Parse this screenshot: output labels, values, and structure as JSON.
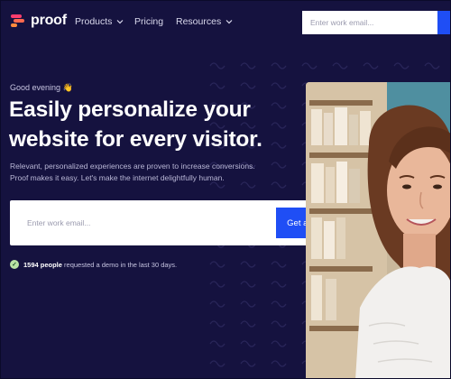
{
  "brand": {
    "name": "proof"
  },
  "nav": {
    "items": [
      {
        "label": "Products",
        "has_dropdown": true
      },
      {
        "label": "Pricing",
        "has_dropdown": false
      },
      {
        "label": "Resources",
        "has_dropdown": true
      }
    ],
    "email_placeholder": "Enter work email..."
  },
  "hero": {
    "greeting": "Good evening",
    "greeting_emoji": "👋",
    "headline_line1": "Easily personalize your",
    "headline_line2": "website for every visitor.",
    "subtext_line1": "Relevant, personalized experiences are proven to increase conversions.",
    "subtext_line2": "Proof makes it easy. Let's make the internet delightfully human.",
    "email_placeholder": "Enter work email...",
    "cta_label": "Get a demo",
    "social_proof": {
      "count": "1594 people",
      "rest": "requested a demo in the last 30 days."
    }
  },
  "colors": {
    "background": "#15123f",
    "accent": "#1f4ef5",
    "logo_pink": "#ff3d6e",
    "logo_orange": "#ff8a3d"
  },
  "icons": {
    "logo": "proof-logo-mark",
    "dropdown": "chevron-down-icon",
    "social": "check-badge-icon"
  }
}
